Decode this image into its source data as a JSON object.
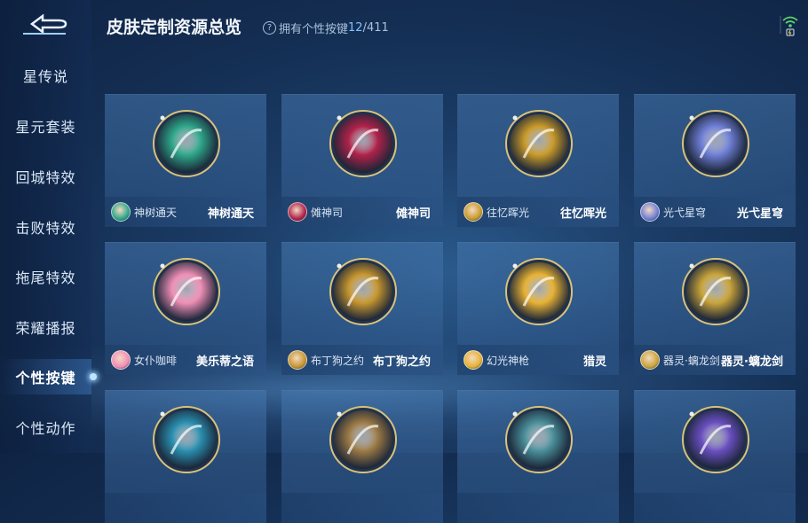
{
  "header": {
    "title": "皮肤定制资源总览",
    "owned_label": "拥有个性按键",
    "owned_count": "12",
    "total_count": "/411"
  },
  "sidebar": {
    "items": [
      {
        "label": "星传说"
      },
      {
        "label": "星元套装"
      },
      {
        "label": "回城特效"
      },
      {
        "label": "击败特效"
      },
      {
        "label": "拖尾特效"
      },
      {
        "label": "荣耀播报"
      },
      {
        "label": "个性按键",
        "active": true
      },
      {
        "label": "个性动作"
      }
    ]
  },
  "cards": [
    {
      "hero": "神树通天",
      "skin": "神树通天",
      "color": "#2fa78a"
    },
    {
      "hero": "傩神司",
      "skin": "傩神司",
      "color": "#b0224a"
    },
    {
      "hero": "往忆晖光",
      "skin": "往忆晖光",
      "color": "#c99a2a"
    },
    {
      "hero": "光弋星穹",
      "skin": "光弋星穹",
      "color": "#6f7fd6"
    },
    {
      "hero": "女仆咖啡",
      "skin": "美乐蒂之语",
      "color": "#f08fb6"
    },
    {
      "hero": "布丁狗之约",
      "skin": "布丁狗之约",
      "color": "#c7962f"
    },
    {
      "hero": "幻光神枪",
      "skin": "猎灵",
      "color": "#e8b234"
    },
    {
      "hero": "器灵·螭龙剑",
      "skin": "器灵·螭龙剑",
      "color": "#c9a43a"
    },
    {
      "hero": "",
      "skin": "",
      "color": "#2a8fb0"
    },
    {
      "hero": "",
      "skin": "",
      "color": "#9c7a45"
    },
    {
      "hero": "",
      "skin": "",
      "color": "#4a8f9a"
    },
    {
      "hero": "",
      "skin": "",
      "color": "#6a4fc0"
    }
  ]
}
